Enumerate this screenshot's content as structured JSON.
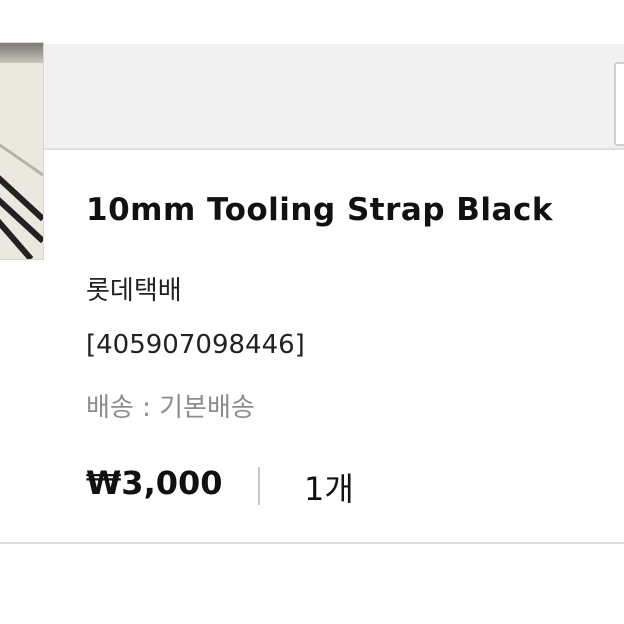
{
  "order_item": {
    "product_name": "10mm Tooling Strap Black",
    "courier": "롯데택배",
    "tracking_number": "[405907098446]",
    "shipping": "배송 : 기본배송",
    "price": "₩3,000",
    "quantity": "1개"
  },
  "icons": {
    "thumbnail": "product-thumbnail"
  },
  "colors": {
    "header_background": "#f1f1f1",
    "primary_text": "#111111",
    "secondary_text": "#8d8d8d",
    "divider": "#c8c8c8"
  }
}
